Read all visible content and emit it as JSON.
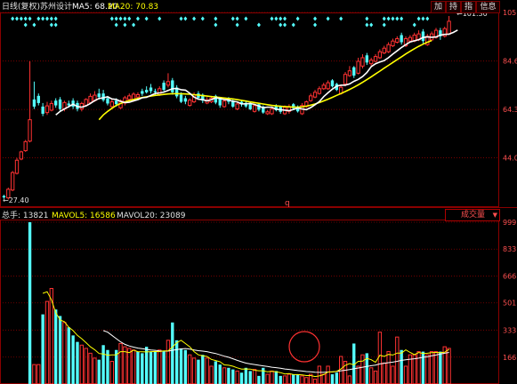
{
  "header": {
    "period_label": "日线(复权)",
    "stock_name": "苏州设计",
    "ma5_label": "MA5: 68.20",
    "ma20_label": "MA20: 70.83"
  },
  "buttons": [
    "加",
    "持",
    "指",
    "信息"
  ],
  "price_axis": {
    "ticks": [
      "105",
      "84.6",
      "64.3",
      "44.0"
    ],
    "high_marker": "101.30",
    "low_marker": "27.40",
    "q_marker": "q"
  },
  "volume_header": {
    "total_label": "总手: 13821",
    "mavol5_label": "MAVOL5: 16586",
    "mavol20_label": "MAVOL20: 23089",
    "dropdown_label": "成交量",
    "dropdown_arrow": "▼"
  },
  "volume_axis": {
    "ticks": [
      "999",
      "833",
      "666",
      "501",
      "333",
      "166"
    ]
  },
  "colors": {
    "background": "#000000",
    "up": "#ff3232",
    "down": "#54ffff",
    "ma5": "#ffffff",
    "ma20": "#ffff00",
    "grid": "#8a0000",
    "axis_text": "#ff5050",
    "signal": "#54ffff"
  },
  "chart_data": {
    "type": "candlestick",
    "price_ylim": [
      23.7,
      105
    ],
    "series_close": [
      27.4,
      30.8,
      37.8,
      43.0,
      46.5,
      50.8,
      60.0,
      65.5,
      67.0,
      62.5,
      65.8,
      66.8,
      66.0,
      64.5,
      67.2,
      66.0,
      65.5,
      64.5,
      66.8,
      68.5,
      69.8,
      70.3,
      69.5,
      68.2,
      66.8,
      67.5,
      66.5,
      67.9,
      69.2,
      70.0,
      70.7,
      70.5,
      70.9,
      71.5,
      72.0,
      71.5,
      73.0,
      72.5,
      76.0,
      71.5,
      69.8,
      67.5,
      67.6,
      68.2,
      70.5,
      69.2,
      68.0,
      68.3,
      69.0,
      67.2,
      66.0,
      67.8,
      67.5,
      65.5,
      66.6,
      66.4,
      65.6,
      64.4,
      65.9,
      64.2,
      63.0,
      63.3,
      64.5,
      64.0,
      63.3,
      65.2,
      65.5,
      64.8,
      63.5,
      66.0,
      67.5,
      70.0,
      71.5,
      73.0,
      74.5,
      75.5,
      74.0,
      72.5,
      73.6,
      79.0,
      80.5,
      78.5,
      84.5,
      86.0,
      84.0,
      85.0,
      86.5,
      88.5,
      90.0,
      91.5,
      93.0,
      94.0,
      92.5,
      94.0,
      94.5,
      95.5,
      96.0,
      93.0,
      95.0,
      96.0,
      97.5,
      95.0,
      98.2,
      101.3
    ],
    "series_open": [
      28.0,
      27.2,
      30.5,
      37.5,
      43.5,
      47.0,
      51.0,
      68.5,
      70.0,
      65.5,
      63.0,
      64.0,
      68.0,
      68.5,
      64.5,
      66.8,
      68.0,
      67.0,
      64.5,
      66.0,
      67.2,
      68.0,
      71.0,
      71.0,
      69.0,
      65.5,
      68.0,
      65.0,
      67.0,
      68.5,
      68.0,
      69.5,
      72.0,
      72.5,
      73.5,
      72.0,
      70.5,
      75.5,
      74.5,
      76.5,
      73.5,
      70.5,
      69.0,
      66.0,
      67.5,
      71.0,
      70.5,
      67.0,
      67.5,
      70.0,
      69.0,
      65.5,
      69.0,
      68.0,
      64.5,
      67.5,
      67.0,
      67.0,
      63.5,
      66.5,
      65.5,
      62.5,
      62.5,
      65.8,
      65.5,
      62.5,
      63.5,
      66.5,
      65.5,
      62.5,
      65.5,
      68.0,
      69.5,
      71.0,
      73.0,
      73.0,
      76.5,
      75.0,
      71.0,
      75.0,
      78.5,
      82.0,
      79.5,
      82.5,
      87.0,
      83.5,
      84.5,
      86.0,
      88.0,
      88.5,
      91.0,
      92.5,
      95.5,
      91.0,
      93.0,
      93.0,
      93.5,
      97.0,
      91.5,
      93.5,
      94.5,
      97.5,
      95.0,
      96.0
    ],
    "series_high": [
      28.5,
      31.5,
      38.5,
      44.0,
      47.0,
      51.5,
      84.5,
      76.0,
      71.0,
      67.0,
      67.5,
      68.0,
      69.0,
      69.5,
      68.0,
      68.0,
      69.0,
      68.0,
      67.5,
      69.0,
      71.0,
      72.0,
      73.0,
      72.5,
      70.0,
      68.5,
      69.0,
      68.5,
      70.0,
      71.0,
      71.5,
      71.5,
      73.0,
      74.0,
      75.0,
      73.0,
      74.0,
      76.5,
      79.5,
      77.5,
      74.5,
      71.5,
      70.0,
      69.0,
      71.5,
      72.0,
      71.0,
      69.5,
      70.0,
      70.5,
      69.5,
      68.5,
      69.5,
      68.5,
      67.5,
      68.0,
      68.0,
      67.5,
      66.5,
      67.0,
      66.0,
      64.0,
      65.5,
      66.5,
      66.0,
      66.0,
      66.5,
      67.0,
      66.0,
      67.0,
      68.0,
      71.0,
      72.5,
      74.0,
      75.5,
      76.5,
      77.0,
      75.5,
      74.5,
      80.0,
      82.5,
      82.5,
      86.0,
      87.5,
      88.0,
      86.0,
      87.5,
      89.5,
      91.0,
      92.5,
      94.0,
      95.0,
      96.5,
      95.0,
      95.5,
      96.5,
      97.5,
      98.0,
      96.0,
      97.0,
      98.5,
      98.5,
      99.0,
      103.5
    ],
    "series_low": [
      26.8,
      26.5,
      30.0,
      37.0,
      43.0,
      46.5,
      50.5,
      64.5,
      66.0,
      61.5,
      62.0,
      63.5,
      65.0,
      63.5,
      63.5,
      65.0,
      64.5,
      63.5,
      63.5,
      65.5,
      66.5,
      67.5,
      68.5,
      67.5,
      66.0,
      64.5,
      65.5,
      64.5,
      66.0,
      67.5,
      67.5,
      69.0,
      70.0,
      71.0,
      71.0,
      70.5,
      70.0,
      72.0,
      73.5,
      70.5,
      69.0,
      67.0,
      66.5,
      65.5,
      67.0,
      68.5,
      67.0,
      66.5,
      67.0,
      66.5,
      65.0,
      65.0,
      66.5,
      65.0,
      64.0,
      65.5,
      65.0,
      64.0,
      63.0,
      63.5,
      62.5,
      62.0,
      62.0,
      63.5,
      62.5,
      62.0,
      62.5,
      64.0,
      63.0,
      62.0,
      65.0,
      67.5,
      69.0,
      70.5,
      72.5,
      72.5,
      73.5,
      72.0,
      70.5,
      74.0,
      78.0,
      77.5,
      79.0,
      81.5,
      83.0,
      82.5,
      84.0,
      85.5,
      87.5,
      88.0,
      90.5,
      92.0,
      91.5,
      90.5,
      92.5,
      92.5,
      93.0,
      92.0,
      91.0,
      93.0,
      94.0,
      93.5,
      94.5,
      95.5
    ],
    "ma5": [
      null,
      null,
      null,
      null,
      null,
      null,
      null,
      null,
      null,
      null,
      null,
      null,
      62.0,
      63.5,
      64.5,
      65.5,
      66.5,
      65.5,
      65.3,
      65.8,
      66.8,
      68.0,
      68.9,
      69.2,
      69.6,
      68.7,
      68.5,
      67.7,
      67.2,
      67.3,
      67.9,
      68.4,
      69.2,
      69.4,
      70.2,
      71.0,
      71.2,
      71.6,
      72.3,
      73.0,
      73.1,
      72.6,
      72.4,
      71.1,
      69.5,
      68.6,
      68.4,
      67.9,
      68.4,
      69.2,
      68.9,
      68.4,
      68.3,
      67.7,
      67.5,
      66.6,
      66.7,
      66.8,
      66.4,
      65.7,
      65.0,
      65.3,
      65.2,
      64.4,
      64.2,
      64.0,
      63.8,
      64.3,
      64.9,
      64.5,
      64.2,
      65.1,
      66.3,
      67.6,
      69.7,
      71.3,
      72.8,
      74.1,
      74.5,
      74.5,
      75.0,
      76.1,
      76.9,
      78.1,
      79.8,
      82.3,
      83.5,
      84.2,
      84.8,
      86.0,
      87.5,
      88.9,
      90.3,
      91.5,
      92.6,
      93.1,
      93.6,
      94.5,
      94.8,
      94.6,
      94.7,
      95.5,
      95.8,
      95.9,
      96.6,
      97.6
    ],
    "ma20": [
      null,
      null,
      null,
      null,
      null,
      null,
      null,
      null,
      null,
      null,
      null,
      null,
      null,
      null,
      null,
      null,
      null,
      null,
      null,
      null,
      null,
      null,
      60.0,
      62.0,
      63.5,
      64.8,
      66.0,
      66.8,
      67.5,
      68.0,
      68.5,
      68.9,
      69.3,
      69.6,
      69.9,
      70.2,
      70.4,
      70.6,
      70.8,
      70.9,
      70.9,
      70.9,
      70.8,
      70.7,
      70.5,
      70.3,
      70.1,
      69.9,
      69.7,
      69.5,
      69.3,
      69.1,
      68.9,
      68.7,
      68.4,
      68.1,
      67.8,
      67.5,
      67.2,
      66.9,
      66.6,
      66.3,
      66.0,
      65.8,
      65.6,
      65.5,
      65.4,
      65.3,
      65.3,
      65.4,
      65.7,
      66.1,
      66.6,
      67.2,
      67.9,
      68.6,
      69.4,
      70.2,
      71.0,
      71.8,
      72.7,
      73.6,
      74.6,
      75.7,
      76.8,
      78.0,
      79.2,
      80.4,
      81.6,
      82.8,
      84.0,
      85.2,
      86.4,
      87.6,
      88.7,
      89.8,
      90.8,
      91.7,
      92.5,
      93.2
    ],
    "volume_ylim": [
      0,
      999
    ],
    "volume": [
      0,
      0,
      0,
      0,
      0,
      0,
      999,
      120,
      120,
      430,
      510,
      590,
      460,
      420,
      380,
      350,
      300,
      260,
      240,
      220,
      190,
      160,
      150,
      240,
      210,
      140,
      210,
      250,
      230,
      220,
      210,
      200,
      190,
      230,
      200,
      200,
      210,
      200,
      270,
      380,
      270,
      220,
      210,
      180,
      160,
      150,
      180,
      160,
      110,
      140,
      120,
      100,
      100,
      90,
      80,
      70,
      100,
      80,
      90,
      50,
      100,
      60,
      80,
      80,
      50,
      50,
      60,
      60,
      60,
      50,
      40,
      60,
      30,
      110,
      60,
      110,
      60,
      70,
      170,
      140,
      50,
      250,
      110,
      180,
      190,
      100,
      80,
      320,
      130,
      200,
      110,
      290,
      210,
      110,
      180,
      180,
      200,
      200,
      180,
      200,
      200,
      200,
      230,
      220
    ],
    "volume_up": [
      false,
      false,
      false,
      false,
      false,
      false,
      false,
      true,
      true,
      false,
      true,
      true,
      false,
      false,
      true,
      false,
      false,
      false,
      true,
      true,
      true,
      true,
      false,
      false,
      false,
      true,
      false,
      true,
      true,
      true,
      true,
      false,
      false,
      false,
      false,
      false,
      true,
      false,
      true,
      false,
      false,
      false,
      false,
      true,
      true,
      false,
      false,
      true,
      true,
      false,
      false,
      true,
      false,
      false,
      true,
      false,
      false,
      false,
      true,
      false,
      false,
      true,
      true,
      false,
      false,
      true,
      true,
      false,
      false,
      true,
      true,
      true,
      true,
      true,
      true,
      true,
      false,
      false,
      true,
      true,
      true,
      false,
      true,
      true,
      false,
      true,
      true,
      true,
      true,
      true,
      true,
      true,
      false,
      true,
      true,
      true,
      true,
      false,
      true,
      true,
      true,
      false,
      true,
      true
    ],
    "mavol5": [
      null,
      null,
      null,
      null,
      null,
      null,
      null,
      null,
      null,
      560,
      570,
      520,
      440,
      395,
      385,
      350,
      330,
      300,
      280,
      255,
      230,
      212,
      188,
      185,
      178,
      180,
      180,
      200,
      200,
      194,
      209,
      200,
      199,
      198,
      200,
      201,
      200,
      205,
      205,
      228,
      255,
      270,
      250,
      230,
      200,
      180,
      174,
      170,
      152,
      145,
      138,
      118,
      116,
      110,
      100,
      92,
      93,
      92,
      85,
      82,
      82,
      75,
      78,
      75,
      70,
      62,
      64,
      58,
      58,
      56,
      52,
      52,
      46,
      50,
      58,
      74,
      74,
      78,
      93,
      115,
      126,
      118,
      140,
      141,
      158,
      150,
      134,
      178,
      170,
      183,
      179,
      191,
      191,
      211,
      195,
      181,
      195,
      188,
      190,
      193,
      195,
      193,
      196,
      214
    ],
    "mavol20": [
      null,
      null,
      null,
      null,
      null,
      null,
      null,
      null,
      null,
      null,
      null,
      null,
      null,
      null,
      null,
      null,
      null,
      null,
      null,
      null,
      null,
      null,
      null,
      330,
      320,
      300,
      280,
      260,
      245,
      235,
      228,
      222,
      218,
      214,
      210,
      208,
      205,
      203,
      203,
      208,
      213,
      217,
      219,
      215,
      210,
      206,
      203,
      200,
      194,
      188,
      180,
      172,
      165,
      156,
      146,
      137,
      129,
      124,
      120,
      116,
      112,
      108,
      104,
      101,
      97,
      93,
      90,
      86,
      83,
      80,
      77,
      75,
      73,
      72,
      72,
      74,
      75,
      77,
      82,
      85,
      89,
      94,
      99,
      104,
      108,
      113,
      117,
      124,
      128,
      132,
      135,
      140,
      146,
      150,
      153,
      156,
      160,
      165,
      168,
      174,
      179,
      185,
      190,
      195
    ],
    "signal_rows": [
      {
        "y_row": 0,
        "marks": [
          2,
          3,
          4,
          5,
          6,
          8,
          9,
          10,
          11,
          12,
          25,
          26,
          27,
          28,
          29,
          31,
          33,
          36,
          41,
          42,
          44,
          46,
          49,
          53,
          54,
          56,
          62,
          63,
          64,
          65,
          68,
          72,
          75,
          78,
          84,
          88,
          89,
          90,
          91,
          92,
          96,
          97,
          98
        ]
      },
      {
        "y_row": 1,
        "marks": [
          5,
          7,
          11,
          12,
          26,
          28,
          30,
          49,
          54,
          59,
          64,
          65,
          67,
          72,
          84,
          85,
          88,
          95
        ]
      }
    ]
  }
}
